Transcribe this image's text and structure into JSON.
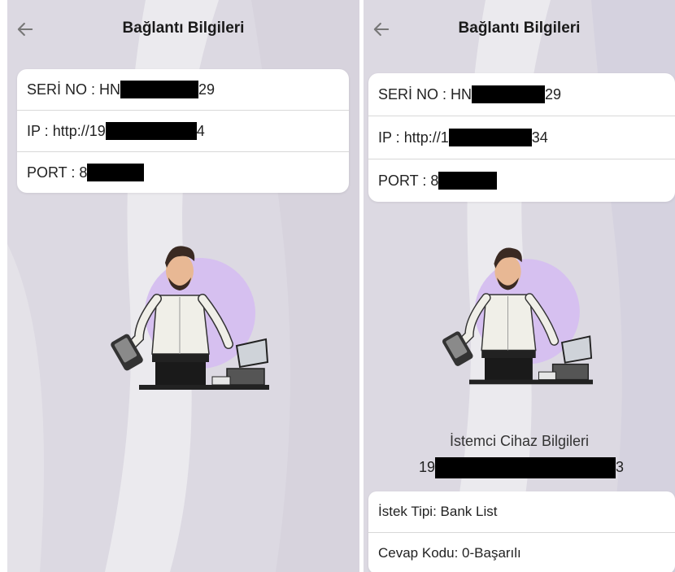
{
  "left": {
    "title": "Bağlantı Bilgileri",
    "serial_label": "SERİ NO :",
    "serial_prefix": "HN",
    "serial_suffix": "29",
    "ip_label": "IP :",
    "ip_prefix": "http://19",
    "ip_suffix": "4",
    "port_label": "PORT :",
    "port_prefix": "8"
  },
  "right": {
    "title": "Bağlantı Bilgileri",
    "serial_label": "SERİ NO :",
    "serial_prefix": "HN",
    "serial_suffix": "29",
    "ip_label": "IP :",
    "ip_prefix": "http://1",
    "ip_suffix": "34",
    "port_label": "PORT :",
    "port_prefix": "8",
    "client_title": "İstemci Cihaz Bilgileri",
    "client_prefix": "19",
    "client_suffix": "3",
    "request_label": "İstek Tipi:",
    "request_value": "Bank List",
    "response_label": "Cevap Kodu:",
    "response_value": "0-Başarılı"
  },
  "colors": {
    "background": "#dddae3",
    "card": "#ffffff",
    "accent_circle": "#d6c0f0",
    "redaction": "#000000"
  },
  "icons": {
    "back": "arrow-left-icon"
  }
}
